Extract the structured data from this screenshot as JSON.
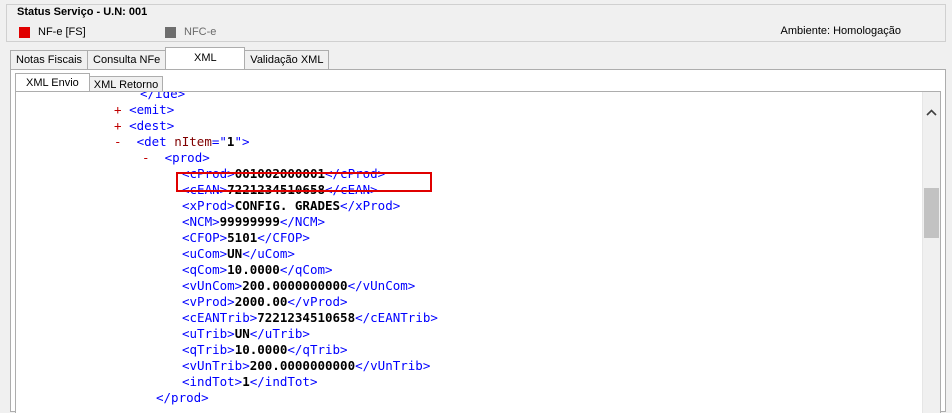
{
  "status": {
    "title": "Status Serviço - U.N: 001",
    "nfe_label": "NF-e  [FS]",
    "nfce_label": "NFC-e",
    "env_label": "Ambiente: Homologação",
    "nfe_color": "#e00000",
    "nfce_color": "#6e6e6e"
  },
  "tabs": [
    "Notas Fiscais",
    "Consulta NFe",
    "XML",
    "Validação XML"
  ],
  "subtabs": [
    "XML Envio",
    "XML Retorno"
  ],
  "xml": {
    "line_top": "</ide>",
    "emit": "<emit>",
    "dest": "<dest>",
    "det_open": "<det",
    "det_attr": " nItem",
    "det_eq": "=\"",
    "det_val": "1",
    "det_close": "\">",
    "prod_open": "<prod>",
    "prod_close": "</prod>",
    "plus": "+",
    "minus": "-",
    "fields": [
      {
        "tag": "cProd",
        "value": "001002000001"
      },
      {
        "tag": "cEAN",
        "value": "7221234510658"
      },
      {
        "tag": "xProd",
        "value": "CONFIG. GRADES"
      },
      {
        "tag": "NCM",
        "value": "99999999"
      },
      {
        "tag": "CFOP",
        "value": "5101"
      },
      {
        "tag": "uCom",
        "value": "UN"
      },
      {
        "tag": "qCom",
        "value": "10.0000"
      },
      {
        "tag": "vUnCom",
        "value": "200.0000000000"
      },
      {
        "tag": "vProd",
        "value": "2000.00"
      },
      {
        "tag": "cEANTrib",
        "value": "7221234510658"
      },
      {
        "tag": "uTrib",
        "value": "UN"
      },
      {
        "tag": "qTrib",
        "value": "10.0000"
      },
      {
        "tag": "vUnTrib",
        "value": "200.0000000000"
      },
      {
        "tag": "indTot",
        "value": "1"
      }
    ]
  },
  "scrollbar": {
    "up_icon": "chevron-up-icon"
  }
}
